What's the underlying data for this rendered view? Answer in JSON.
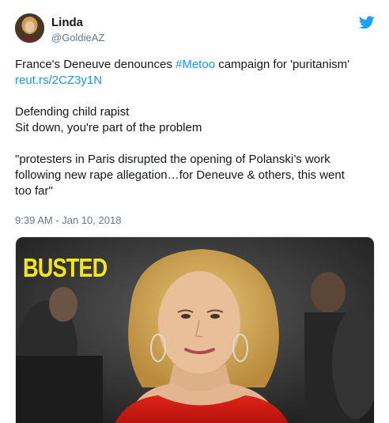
{
  "author": {
    "name": "Linda",
    "handle": "@GoldieAZ",
    "avatar_icon": "avatar-photo"
  },
  "brand_icon": "twitter-bird-icon",
  "colors": {
    "link": "#1b95e0",
    "bird": "#1da1f2",
    "muted": "#657786",
    "badge": "#f5e61a"
  },
  "tweet": {
    "line1_prefix": "France's Deneuve denounces ",
    "hashtag": "#Metoo",
    "line1_suffix": " campaign for 'puritanism'",
    "link": "reut.rs/2CZ3y1N",
    "line2": "Defending child rapist",
    "line3": "Sit down, you're part of the problem",
    "quote_line1": "\"protesters in Paris disrupted the opening of Polanski’s work",
    "quote_line2": "following new rape allegation…for Deneuve & others, this went",
    "quote_line3": "too far\""
  },
  "timestamp": "9:39 AM - Jan 10, 2018",
  "media": {
    "overlay_text": "BUSTED"
  }
}
